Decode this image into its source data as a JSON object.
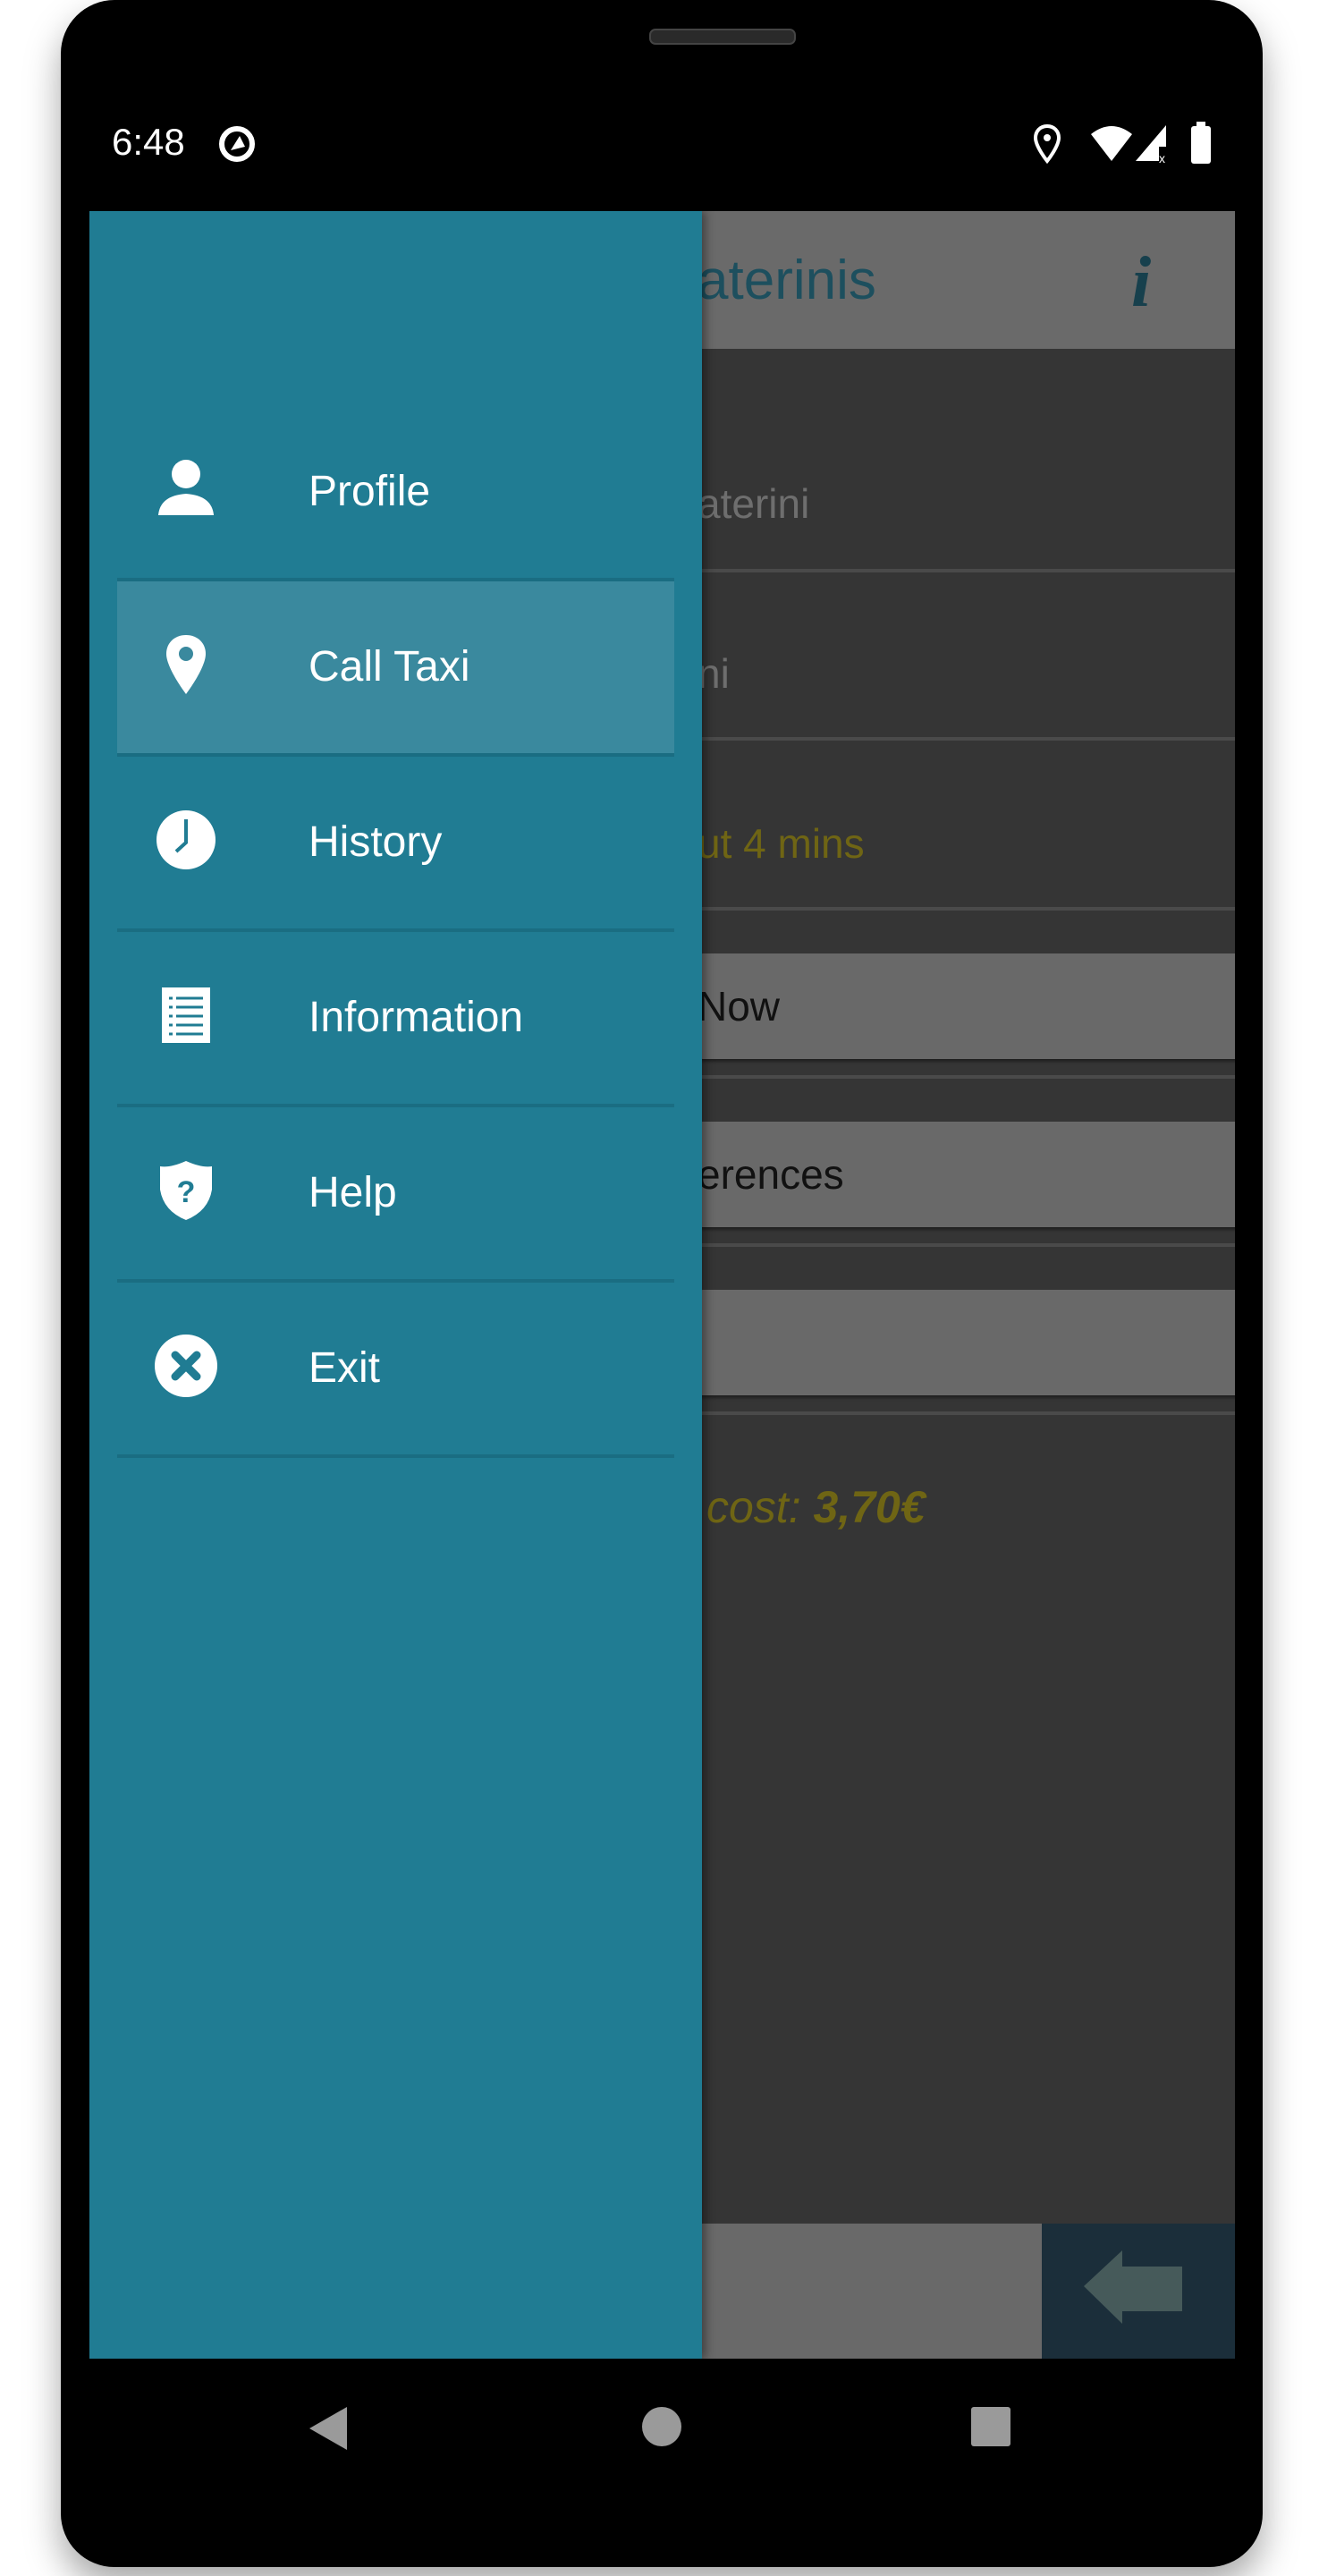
{
  "status_bar": {
    "time": "6:48",
    "icons": [
      "assistant-icon",
      "location-icon",
      "wifi-icon",
      "signal-no-data-icon",
      "battery-icon"
    ]
  },
  "app": {
    "header_title": "aterinis",
    "info_icon": "info-icon",
    "fields": [
      "aterini",
      "ni"
    ],
    "eta": "ut 4 mins",
    "buttons": [
      "Now",
      "erences",
      ""
    ],
    "cost_label": "cost:",
    "cost_value": "3,70€",
    "back_icon": "arrow-left-icon"
  },
  "drawer": {
    "items": [
      {
        "label": "Profile",
        "icon": "person-icon"
      },
      {
        "label": "Call Taxi",
        "icon": "map-pin-icon",
        "selected": true
      },
      {
        "label": "History",
        "icon": "clock-icon"
      },
      {
        "label": "Information",
        "icon": "list-icon"
      },
      {
        "label": "Help",
        "icon": "shield-question-icon"
      },
      {
        "label": "Exit",
        "icon": "close-circle-icon"
      }
    ]
  },
  "colors": {
    "drawer": "#207c93",
    "selected": "#3a899e",
    "accent_text": "#6f6514"
  },
  "nav_bar": [
    "back-icon",
    "home-icon",
    "recents-icon"
  ]
}
